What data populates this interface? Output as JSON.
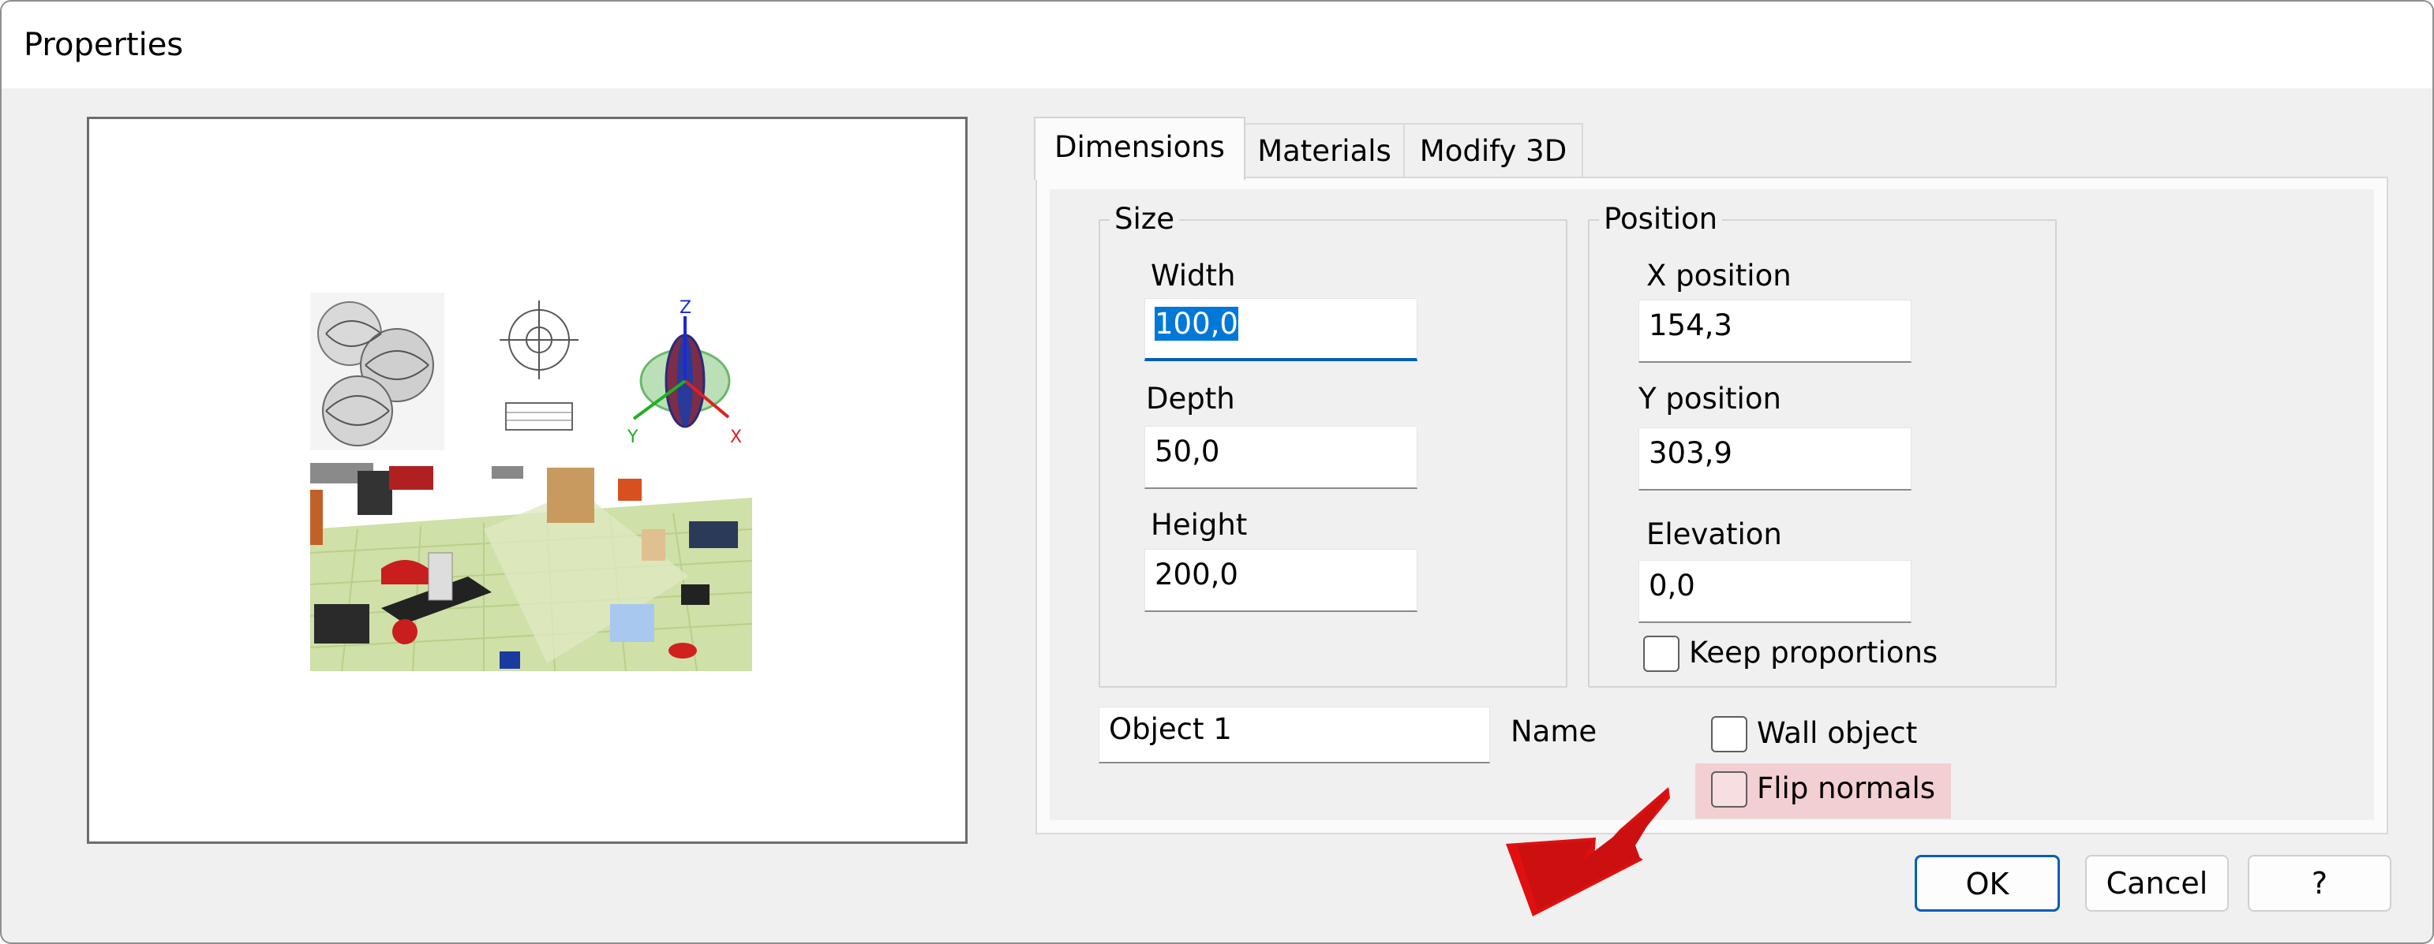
{
  "window": {
    "title": "Properties"
  },
  "tabs": [
    "Dimensions",
    "Materials",
    "Modify 3D"
  ],
  "size_group": {
    "label": "Size",
    "width_label": "Width",
    "width_value": "100,0",
    "depth_label": "Depth",
    "depth_value": "50,0",
    "height_label": "Height",
    "height_value": "200,0"
  },
  "position_group": {
    "label": "Position",
    "x_label": "X position",
    "x_value": "154,3",
    "y_label": "Y position",
    "y_value": "303,9",
    "elevation_label": "Elevation",
    "elevation_value": "0,0",
    "keep_proportions_label": "Keep proportions",
    "keep_proportions_checked": false
  },
  "name_field": {
    "value": "Object 1",
    "label": "Name"
  },
  "wall_object": {
    "label": "Wall object",
    "checked": false
  },
  "flip_normals": {
    "label": "Flip normals",
    "checked": false,
    "highlighted": true
  },
  "preview": {
    "axis_labels": {
      "z": "Z",
      "y": "Y",
      "x": "X"
    },
    "pointer_icon": "red-arrow-icon"
  },
  "buttons": {
    "ok": "OK",
    "cancel": "Cancel",
    "help": "?"
  },
  "colors": {
    "accent": "#005fb8",
    "highlight": "#f2cfd2",
    "pointer": "#e01010"
  }
}
